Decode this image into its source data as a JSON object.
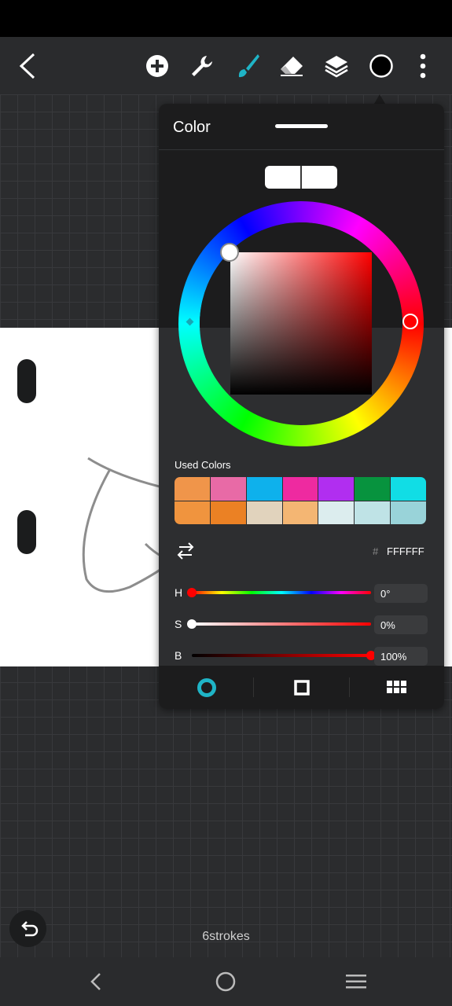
{
  "toolbar": {
    "icons": [
      "back-icon",
      "add-icon",
      "wrench-icon",
      "brush-icon",
      "eraser-icon",
      "layers-icon",
      "color-icon",
      "more-icon"
    ]
  },
  "color_panel": {
    "title": "Color",
    "used_colors_label": "Used Colors",
    "used_colors": [
      "#f0954a",
      "#e86aa6",
      "#0eb1ec",
      "#ee2aa0",
      "#b12ef0",
      "#07933e",
      "#11dde5",
      "#f0943e",
      "#eb8124",
      "#e1d3bd",
      "#f4b673",
      "#dcedee",
      "#bfe3e6",
      "#99d3d9"
    ],
    "hash_symbol": "#",
    "hex_value": "FFFFFF",
    "sliders": [
      {
        "label": "H",
        "value": "0°",
        "level": 0
      },
      {
        "label": "S",
        "value": "0%",
        "level": 0
      },
      {
        "label": "B",
        "value": "100%",
        "level": 1
      }
    ],
    "tabs": [
      "wheel-tab",
      "square-tab",
      "palette-tab"
    ]
  },
  "status": {
    "stroke_count": "6strokes"
  },
  "colors": {
    "accent": "#1fb4c6",
    "panel_bg": "#2d2e30",
    "toolbar_bg": "#2a2b2d"
  }
}
